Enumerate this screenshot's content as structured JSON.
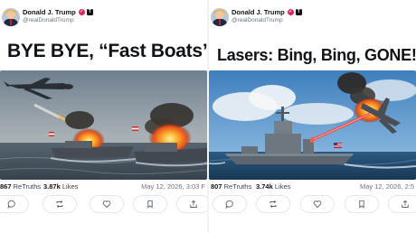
{
  "posts": [
    {
      "author_name": "Donald J. Trump",
      "author_handle": "@realDonaldTrump",
      "headline": "BYE BYE, “Fast Boats”",
      "retruths_count": "867",
      "retruths_label": "ReTruths",
      "likes_count": "3.87k",
      "likes_label": "Likes",
      "timestamp": "May 12, 2026, 3:03 F"
    },
    {
      "author_name": "Donald J. Trump",
      "author_handle": "@realDonaldTrump",
      "headline": "Lasers: Bing, Bing, GONE!!",
      "retruths_count": "807",
      "retruths_label": "ReTruths",
      "likes_count": "3.74k",
      "likes_label": "Likes",
      "timestamp": "May 12, 2026, 2:5"
    }
  ],
  "icons": [
    "reply-icon",
    "retruth-icon",
    "like-icon",
    "bookmark-icon",
    "share-icon"
  ],
  "colors": {
    "verified_badge": "#e0245e",
    "border": "#e3e6ea",
    "muted_text": "#6a7480"
  }
}
